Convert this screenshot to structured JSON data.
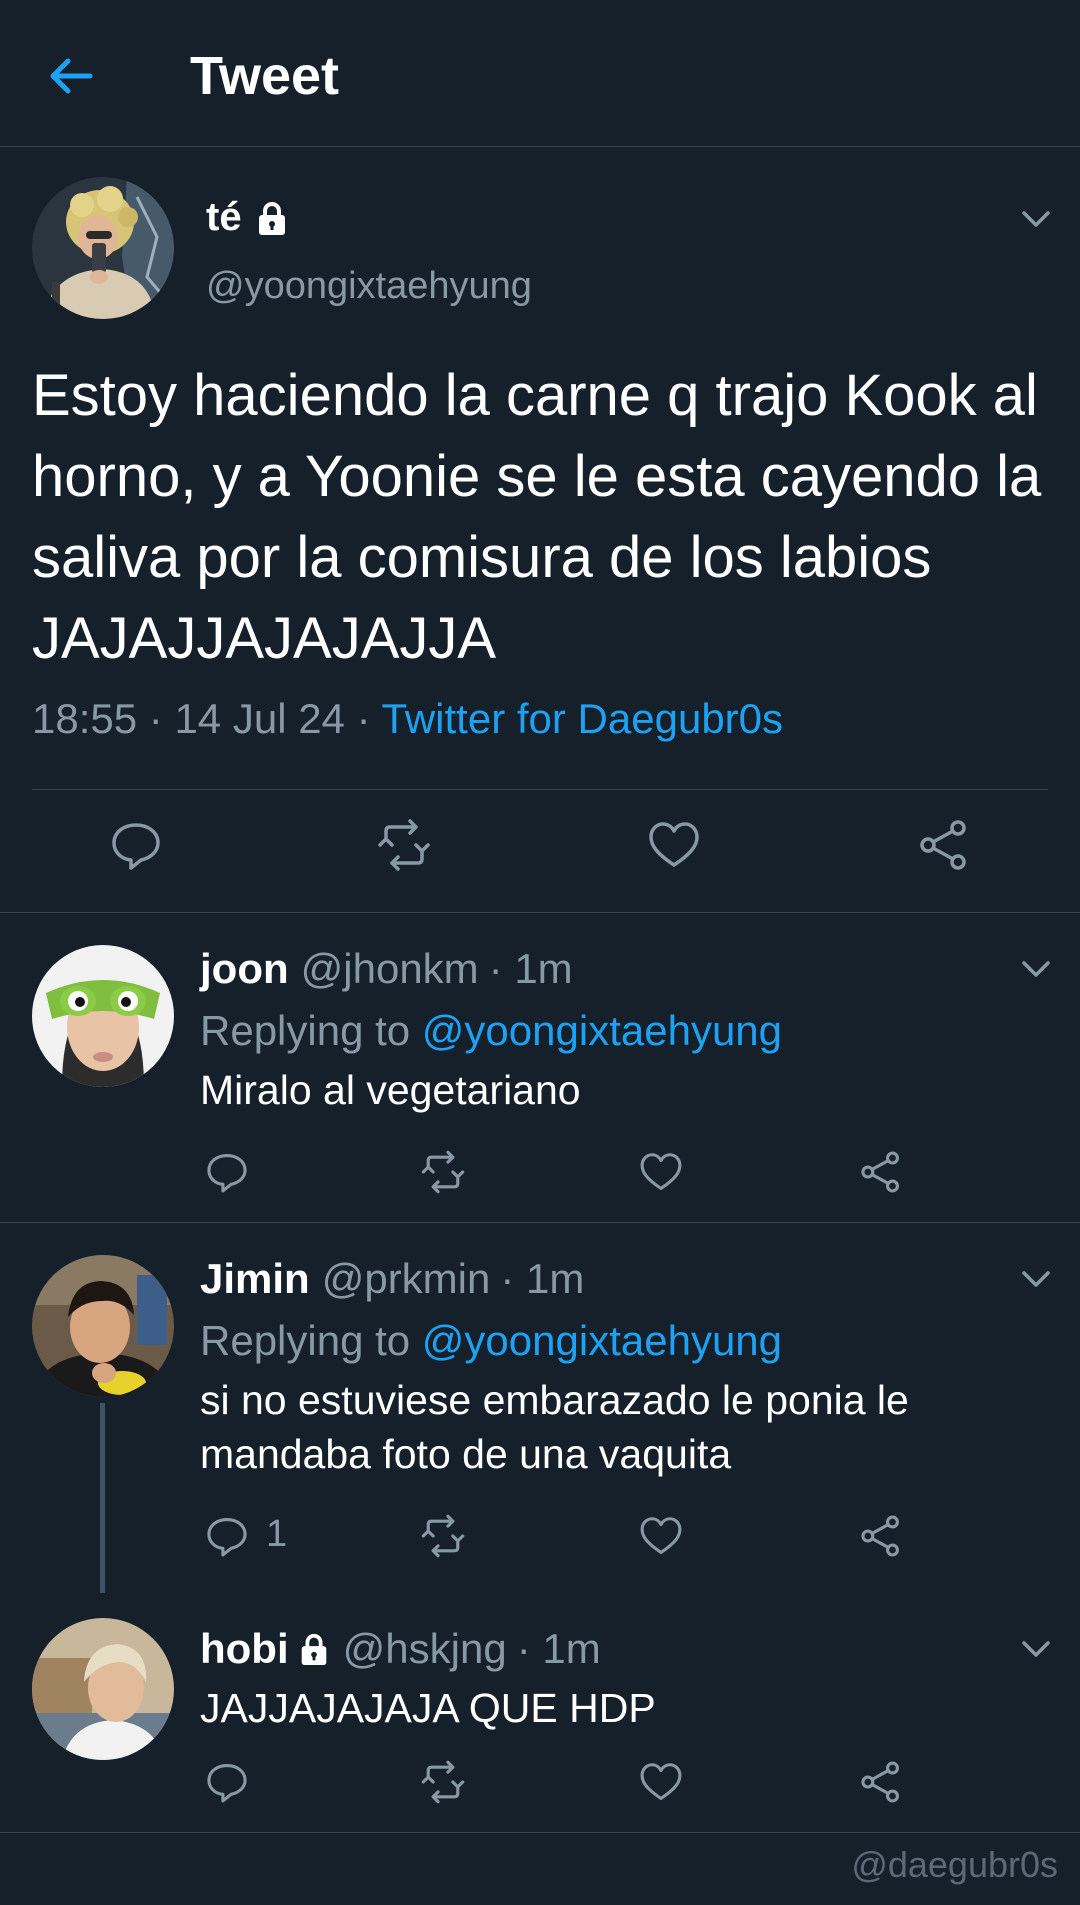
{
  "header": {
    "title": "Tweet",
    "back_icon": "arrow-left-icon"
  },
  "main_tweet": {
    "display_name": "té",
    "handle": "@yoongixtaehyung",
    "text": "Estoy haciendo la carne q trajo Kook al horno, y a Yoonie se le esta cayendo la saliva por la comisura de los labios JAJAJJAJAJAJJA",
    "time": "18:55",
    "date": "14 Jul 24",
    "separator": "·",
    "source": "Twitter for Daegubr0s",
    "actions": [
      "reply-icon",
      "retweet-icon",
      "like-icon",
      "share-icon"
    ]
  },
  "replies": [
    {
      "display_name": "joon",
      "handle": "@jhonkm",
      "time": "· 1m",
      "replying_prefix": "Replying to",
      "replying_to": "@yoongixtaehyung",
      "text": "Miralo al vegetariano",
      "reply_count": ""
    },
    {
      "display_name": "Jimin",
      "handle": "@prkmin",
      "time": "· 1m",
      "replying_prefix": "Replying to",
      "replying_to": "@yoongixtaehyung",
      "text": "si no estuviese embarazado le ponia le mandaba foto de una vaquita",
      "reply_count": "1"
    },
    {
      "display_name": "hobi",
      "handle": "@hskjng",
      "time": "· 1m",
      "text": "JAJJAJAJAJA QUE HDP",
      "reply_count": ""
    }
  ],
  "watermark": "@daegubr0s",
  "colors": {
    "background": "#15202b",
    "divider": "#38444d",
    "accent": "#1da1f2",
    "secondary_text": "#8899a6"
  }
}
